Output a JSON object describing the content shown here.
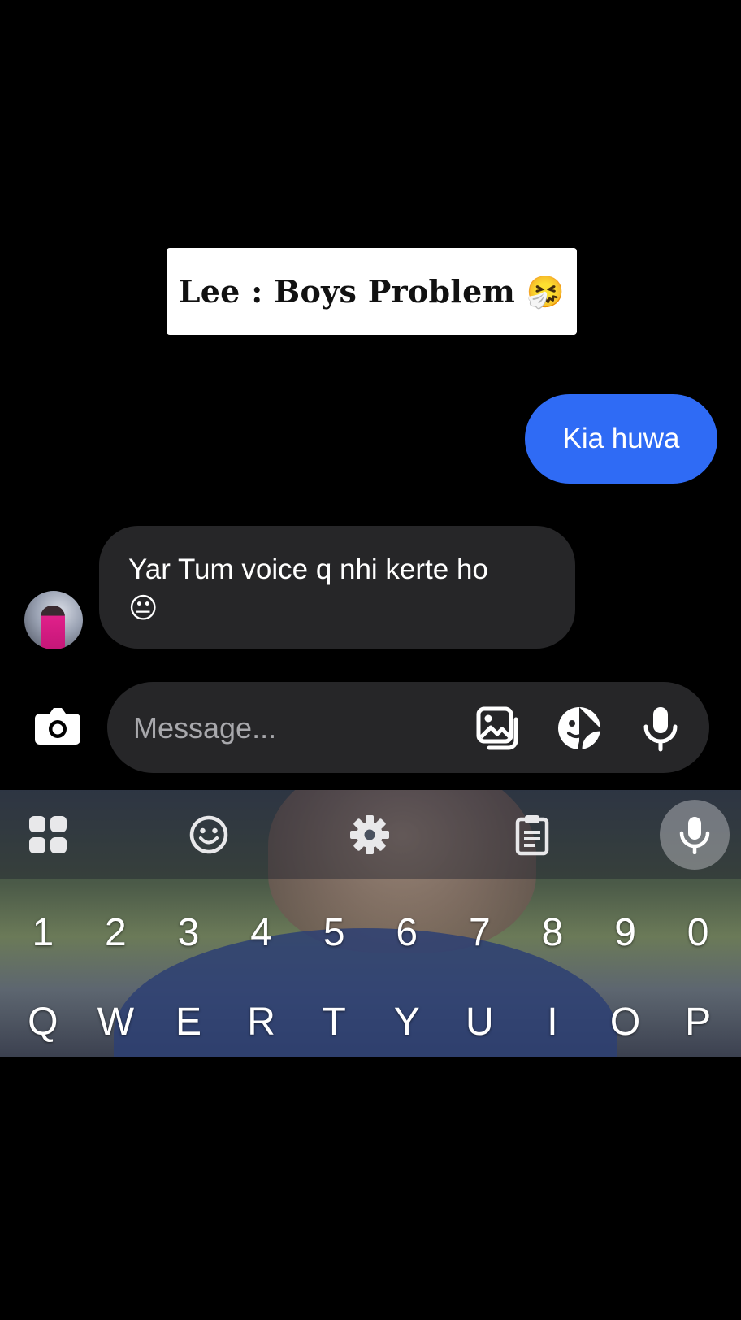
{
  "overlay": {
    "title": "Lee : Boys Problem",
    "title_emoji": "🤧"
  },
  "chat": {
    "sent_messages": [
      {
        "text": "Kia huwa"
      }
    ],
    "received_messages": [
      {
        "text_line1": "Yar Tum voice q nhi kerte ho",
        "emoji": "😐"
      }
    ]
  },
  "composer": {
    "placeholder": "Message...",
    "value": "",
    "icons": [
      "camera-icon",
      "gallery-icon",
      "sticker-icon",
      "microphone-icon"
    ]
  },
  "keyboard": {
    "toolbar_icons": [
      "apps-grid-icon",
      "emoji-icon",
      "settings-icon",
      "clipboard-icon",
      "voice-input-icon"
    ],
    "number_row": [
      "1",
      "2",
      "3",
      "4",
      "5",
      "6",
      "7",
      "8",
      "9",
      "0"
    ],
    "letter_row_1": [
      "Q",
      "W",
      "E",
      "R",
      "T",
      "Y",
      "U",
      "I",
      "O",
      "P"
    ]
  },
  "colors": {
    "background": "#000000",
    "sent_bubble": "#2f6bf5",
    "received_bubble": "#262628",
    "composer": "#262628",
    "title_card": "#ffffff"
  }
}
